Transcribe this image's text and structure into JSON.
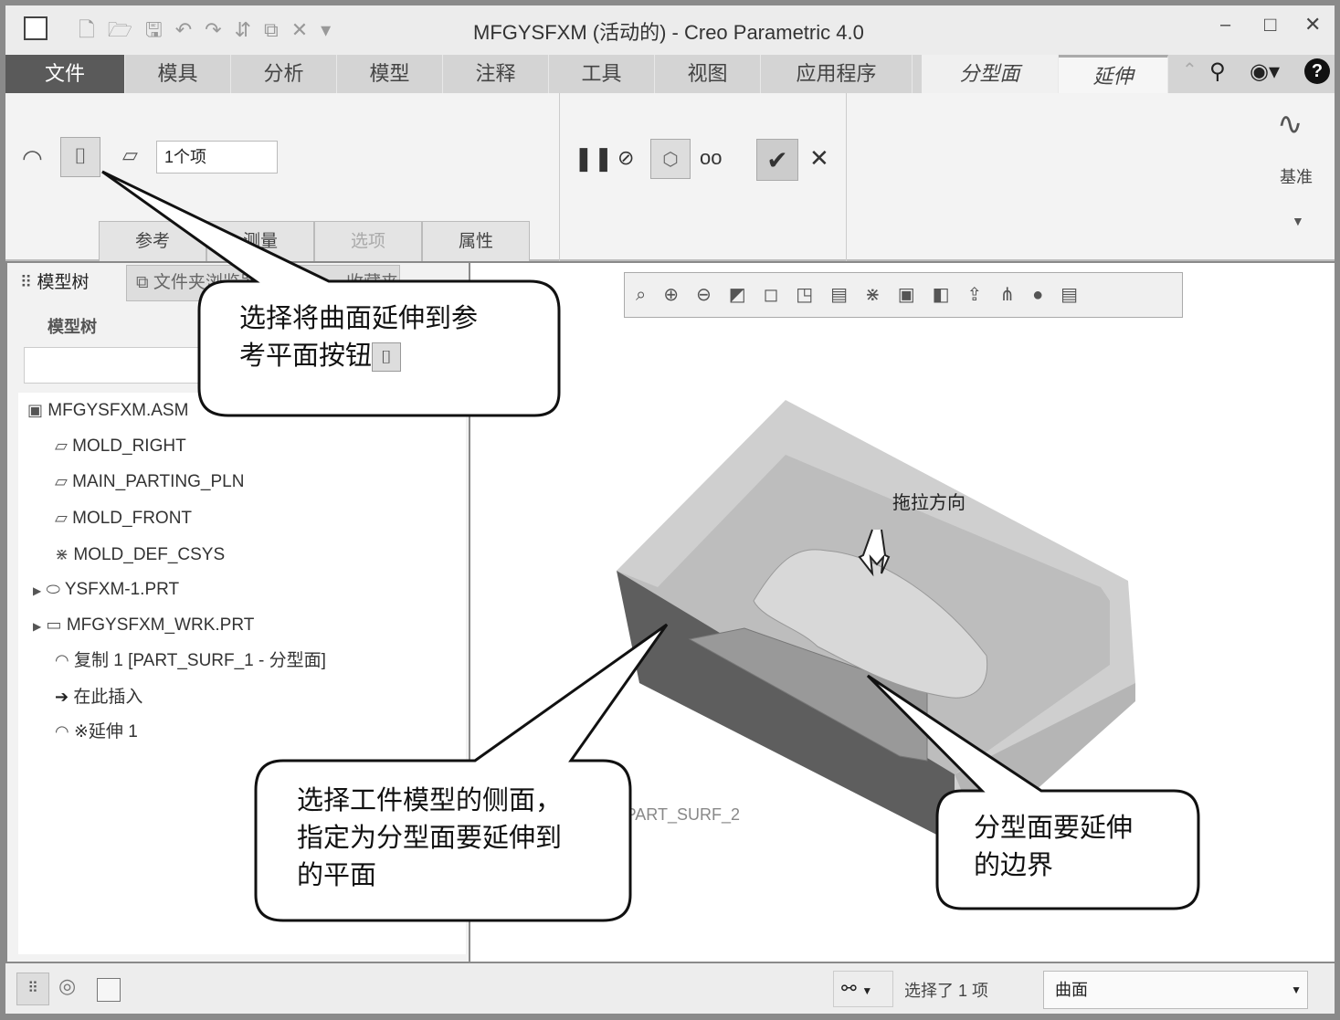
{
  "window": {
    "title": "MFGYSFXM (活动的) - Creo Parametric 4.0",
    "minimize": "–",
    "maximize": "□",
    "close": "✕"
  },
  "ribbon_tabs": [
    "文件",
    "模具",
    "分析",
    "模型",
    "注释",
    "工具",
    "视图",
    "应用程序",
    "分型面",
    "延伸"
  ],
  "extend_tool": {
    "reference_count": "1个项",
    "subtabs": [
      "参考",
      "测量",
      "选项",
      "属性"
    ],
    "datum_label": "基准"
  },
  "left_panel": {
    "tabs": [
      "模型树",
      "文件夹浏览器",
      "收藏夹"
    ],
    "header": "模型树",
    "tree": [
      {
        "label": "MFGYSFXM.ASM",
        "icon": "assembly-icon"
      },
      {
        "label": "MOLD_RIGHT",
        "icon": "datum-plane-icon"
      },
      {
        "label": "MAIN_PARTING_PLN",
        "icon": "datum-plane-icon"
      },
      {
        "label": "MOLD_FRONT",
        "icon": "datum-plane-icon"
      },
      {
        "label": "MOLD_DEF_CSYS",
        "icon": "csys-icon"
      },
      {
        "label": "YSFXM-1.PRT",
        "icon": "part-icon"
      },
      {
        "label": "MFGYSFXM_WRK.PRT",
        "icon": "part-icon"
      },
      {
        "label": "复制 1 [PART_SURF_1 - 分型面]",
        "icon": "surface-icon"
      },
      {
        "label": "在此插入",
        "icon": "insert-arrow-icon"
      },
      {
        "label": "※延伸 1",
        "icon": "surface-icon"
      }
    ]
  },
  "viewport": {
    "drag_direction_label": "拖拉方向",
    "surface_label": "PART_SURF_2"
  },
  "callouts": [
    {
      "text_lines": [
        "选择将曲面延伸到参",
        "考平面按钮"
      ]
    },
    {
      "text_lines": [
        "选择工件模型的侧面，",
        "指定为分型面要延伸到",
        "的平面"
      ]
    },
    {
      "text_lines": [
        "分型面要延伸",
        "的边界"
      ]
    }
  ],
  "status_bar": {
    "selection_text": "选择了 1 项",
    "filter_value": "曲面"
  }
}
